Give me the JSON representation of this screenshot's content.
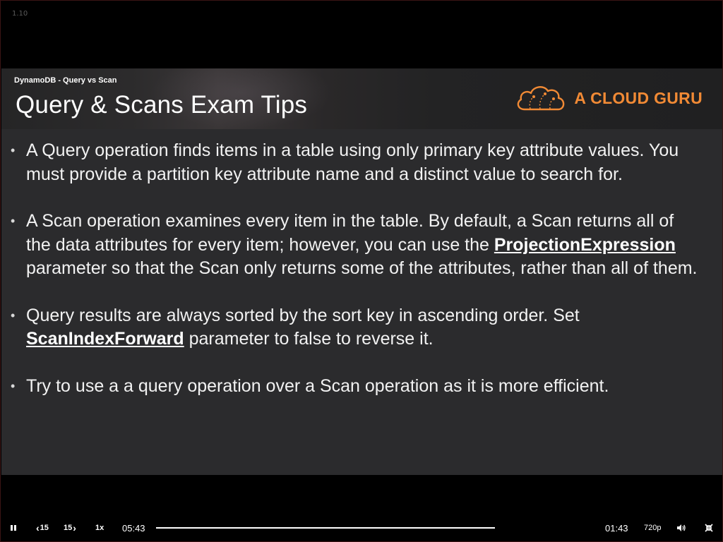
{
  "player": {
    "version_label": "1.10",
    "controls": {
      "play_pause_icon": "pause-icon",
      "rewind_label": "15",
      "forward_label": "15",
      "speed_label": "1x",
      "elapsed_time": "05:43",
      "remaining_time": "01:43",
      "quality_label": "720p",
      "volume_icon": "volume-icon",
      "fullscreen_icon": "exit-fullscreen-icon"
    }
  },
  "slide": {
    "breadcrumb": "DynamoDB - Query vs Scan",
    "title": "Query & Scans Exam Tips",
    "logo_text": "A CLOUD GURU",
    "accent_color": "#f18a35",
    "bullets": [
      {
        "text": "A Query operation finds items in a table using only primary key attribute values. You must provide a partition key attribute name and a distinct value to search for."
      },
      {
        "pre": "A Scan operation examines every item in the table. By default, a Scan returns all of the data attributes for every item; however, you can use the ",
        "bold": "ProjectionExpression",
        "post": " parameter so that the Scan only returns some of the attributes, rather than all of them."
      },
      {
        "pre": "Query results are always sorted by the sort key in ascending order. Set ",
        "bold": "ScanIndexForward",
        "post": " parameter to false to reverse it."
      },
      {
        "text": "Try to use a a query operation over a Scan operation as it is more efficient."
      }
    ]
  }
}
